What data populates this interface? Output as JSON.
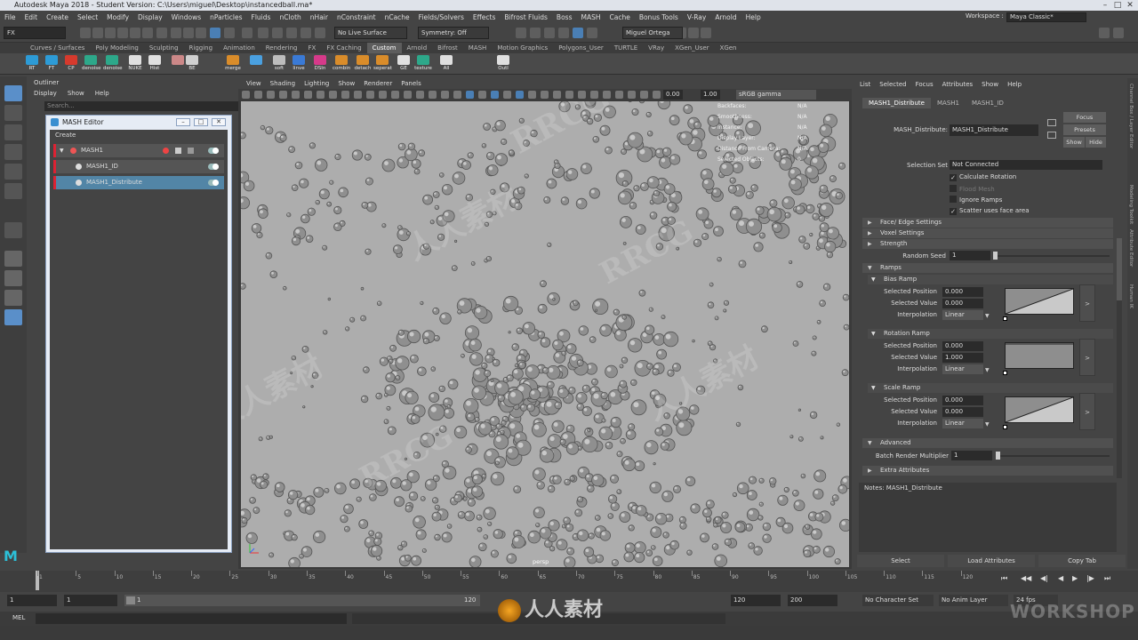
{
  "window": {
    "title": "Autodesk Maya 2018 - Student Version: C:\\Users\\miguel\\Desktop\\instancedball.ma*"
  },
  "menubar": {
    "items": [
      "File",
      "Edit",
      "Create",
      "Select",
      "Modify",
      "Display",
      "Windows",
      "nParticles",
      "Fluids",
      "nCloth",
      "nHair",
      "nConstraint",
      "nCache",
      "Fields/Solvers",
      "Effects",
      "Bifrost Fluids",
      "Boss",
      "MASH",
      "Cache",
      "Bonus Tools",
      "V-Ray",
      "Arnold",
      "Help"
    ],
    "workspace_label": "Workspace :",
    "workspace_value": "Maya Classic*"
  },
  "statusline": {
    "menuset": "FX",
    "live_surface": "No Live Surface",
    "symmetry": "Symmetry: Off",
    "user": "Miguel Ortega"
  },
  "shelf": {
    "tabs": [
      "Curves / Surfaces",
      "Poly Modeling",
      "Sculpting",
      "Rigging",
      "Animation",
      "Rendering",
      "FX",
      "FX Caching",
      "Custom",
      "Arnold",
      "Bifrost",
      "MASH",
      "Motion Graphics",
      "Polygons_User",
      "TURTLE",
      "VRay",
      "XGen_User",
      "XGen"
    ],
    "active_tab": "Custom",
    "buttons": [
      {
        "label": "RT",
        "color": "#2d9bd6"
      },
      {
        "label": "FT",
        "color": "#2d9bd6"
      },
      {
        "label": "CP",
        "color": "#d63a2d"
      },
      {
        "label": "denoise",
        "color": "#2da88a"
      },
      {
        "label": "denoise",
        "color": "#2da88a"
      },
      {
        "label": "NUKE",
        "color": "#e0e0e0"
      },
      {
        "label": "Hist",
        "color": "#e0e0e0"
      },
      {
        "label": "",
        "color": "#c88"
      },
      {
        "label": "BE",
        "color": "#d0d0d0"
      },
      {
        "label": "merge",
        "color": "#d98c2a"
      },
      {
        "label": "",
        "color": "#4aa0e0"
      },
      {
        "label": "soft",
        "color": "#bdbdbd"
      },
      {
        "label": "linve",
        "color": "#3a7ad6"
      },
      {
        "label": "DSIn",
        "color": "#d63a8a"
      },
      {
        "label": "combin",
        "color": "#d98c2a"
      },
      {
        "label": "detach",
        "color": "#d98c2a"
      },
      {
        "label": "seperat",
        "color": "#d98c2a"
      },
      {
        "label": "GE",
        "color": "#e0e0e0"
      },
      {
        "label": "texture",
        "color": "#2da88a"
      },
      {
        "label": "All",
        "color": "#e0e0e0"
      },
      {
        "label": "Outl",
        "color": "#e0e0e0"
      }
    ]
  },
  "outliner": {
    "title": "Outliner",
    "menu": [
      "Display",
      "Show",
      "Help"
    ],
    "search_placeholder": "Search..."
  },
  "mash_editor": {
    "title": "MASH Editor",
    "menu": "Create",
    "nodes": [
      {
        "name": "MASH1",
        "level": 0,
        "selected": false
      },
      {
        "name": "MASH1_ID",
        "level": 1,
        "selected": false
      },
      {
        "name": "MASH1_Distribute",
        "level": 1,
        "selected": true
      }
    ]
  },
  "viewport": {
    "menu": [
      "View",
      "Shading",
      "Lighting",
      "Show",
      "Renderer",
      "Panels"
    ],
    "exposure": "0.00",
    "gamma": "1.00",
    "color_space": "sRGB gamma",
    "camera": "persp",
    "hud": [
      {
        "key": "Backfaces:",
        "value": "N/A"
      },
      {
        "key": "Smoothness:",
        "value": "N/A"
      },
      {
        "key": "Instance:",
        "value": "N/A"
      },
      {
        "key": "Display Layer:",
        "value": "N/A"
      },
      {
        "key": "Distance From Camera:",
        "value": "N/A"
      },
      {
        "key": "Selected Objects:",
        "value": "0"
      }
    ],
    "watermarks": [
      "RRCG",
      "人人素材",
      "RRCG",
      "人人素材",
      "RRCG",
      "人人素材"
    ]
  },
  "attribute_editor": {
    "menu": [
      "List",
      "Selected",
      "Focus",
      "Attributes",
      "Show",
      "Help"
    ],
    "tabs": [
      "MASH1_Distribute",
      "MASH1",
      "MASH1_ID"
    ],
    "node_label": "MASH_Distribute:",
    "node_name": "MASH1_Distribute",
    "focus": "Focus",
    "presets": "Presets",
    "show": "Show",
    "hide": "Hide",
    "selection_set_label": "Selection Set",
    "selection_set_value": "Not Connected",
    "checkboxes": [
      {
        "label": "Calculate Rotation",
        "checked": true,
        "enabled": true
      },
      {
        "label": "Flood Mesh",
        "checked": false,
        "enabled": false
      },
      {
        "label": "Ignore Ramps",
        "checked": false,
        "enabled": true
      },
      {
        "label": "Scatter uses face area",
        "checked": true,
        "enabled": true
      }
    ],
    "sections": [
      "Face/ Edge Settings",
      "Voxel Settings",
      "Strength"
    ],
    "random_seed_label": "Random Seed",
    "random_seed_value": "1",
    "ramps_section": "Ramps",
    "ramps": [
      {
        "title": "Bias Ramp",
        "position": "0.000",
        "value": "0.000",
        "interpolation": "Linear",
        "shape": "diag"
      },
      {
        "title": "Rotation Ramp",
        "position": "0.000",
        "value": "1.000",
        "interpolation": "Linear",
        "shape": "flat"
      },
      {
        "title": "Scale Ramp",
        "position": "0.000",
        "value": "0.000",
        "interpolation": "Linear",
        "shape": "diag"
      }
    ],
    "labels": {
      "selected_position": "Selected Position",
      "selected_value": "Selected Value",
      "interpolation": "Interpolation"
    },
    "advanced_section": "Advanced",
    "batch_label": "Batch Render Multiplier",
    "batch_value": "1",
    "extra_section": "Extra Attributes",
    "notes": "Notes:  MASH1_Distribute",
    "bottom_buttons": [
      "Select",
      "Load Attributes",
      "Copy Tab"
    ]
  },
  "right_strip": [
    "Channel Box / Layer Editor",
    "Modeling Toolkit",
    "Attribute Editor",
    "Human IK"
  ],
  "timeline": {
    "ticks": [
      "1",
      "5",
      "10",
      "15",
      "20",
      "25",
      "30",
      "35",
      "40",
      "45",
      "50",
      "55",
      "60",
      "65",
      "70",
      "75",
      "80",
      "85",
      "90",
      "95",
      "100",
      "105",
      "110",
      "115",
      "120"
    ],
    "current_frame": "1"
  },
  "range": {
    "start": "1",
    "start2": "1",
    "range_start": "1",
    "range_end": "120",
    "end": "120",
    "end2": "200",
    "character_set": "No Character Set",
    "anim_layer": "No Anim Layer",
    "fps": "24 fps"
  },
  "command_line": {
    "label": "MEL"
  },
  "watermark_bottom": "人人素材",
  "watermark_br": "WORKSHOP"
}
